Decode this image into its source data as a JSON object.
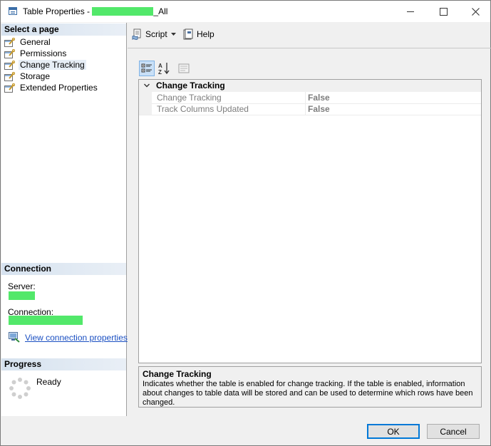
{
  "window": {
    "title_prefix": "Table Properties - ",
    "title_suffix": "_All"
  },
  "left_panel": {
    "select_page_header": "Select a page",
    "pages": [
      {
        "label": "General"
      },
      {
        "label": "Permissions"
      },
      {
        "label": "Change Tracking",
        "selected": true
      },
      {
        "label": "Storage"
      },
      {
        "label": "Extended Properties"
      }
    ],
    "connection_header": "Connection",
    "server_label": "Server:",
    "connection_label": "Connection:",
    "view_connection_link": "View connection properties",
    "progress_header": "Progress",
    "progress_status": "Ready"
  },
  "toolbar": {
    "script_label": "Script",
    "help_label": "Help"
  },
  "property_grid": {
    "category": "Change Tracking",
    "properties": [
      {
        "name": "Change Tracking",
        "value": "False"
      },
      {
        "name": "Track Columns Updated",
        "value": "False"
      }
    ]
  },
  "description": {
    "title": "Change Tracking",
    "text": "Indicates whether the table is enabled for change tracking. If the table is enabled, information about changes to table data will be stored and can be used to determine which rows have been changed."
  },
  "buttons": {
    "ok_label": "OK",
    "cancel_label": "Cancel"
  },
  "colors": {
    "redaction": "#52e86a",
    "link": "#1a4fc2",
    "section_header": "#dae4ef"
  }
}
